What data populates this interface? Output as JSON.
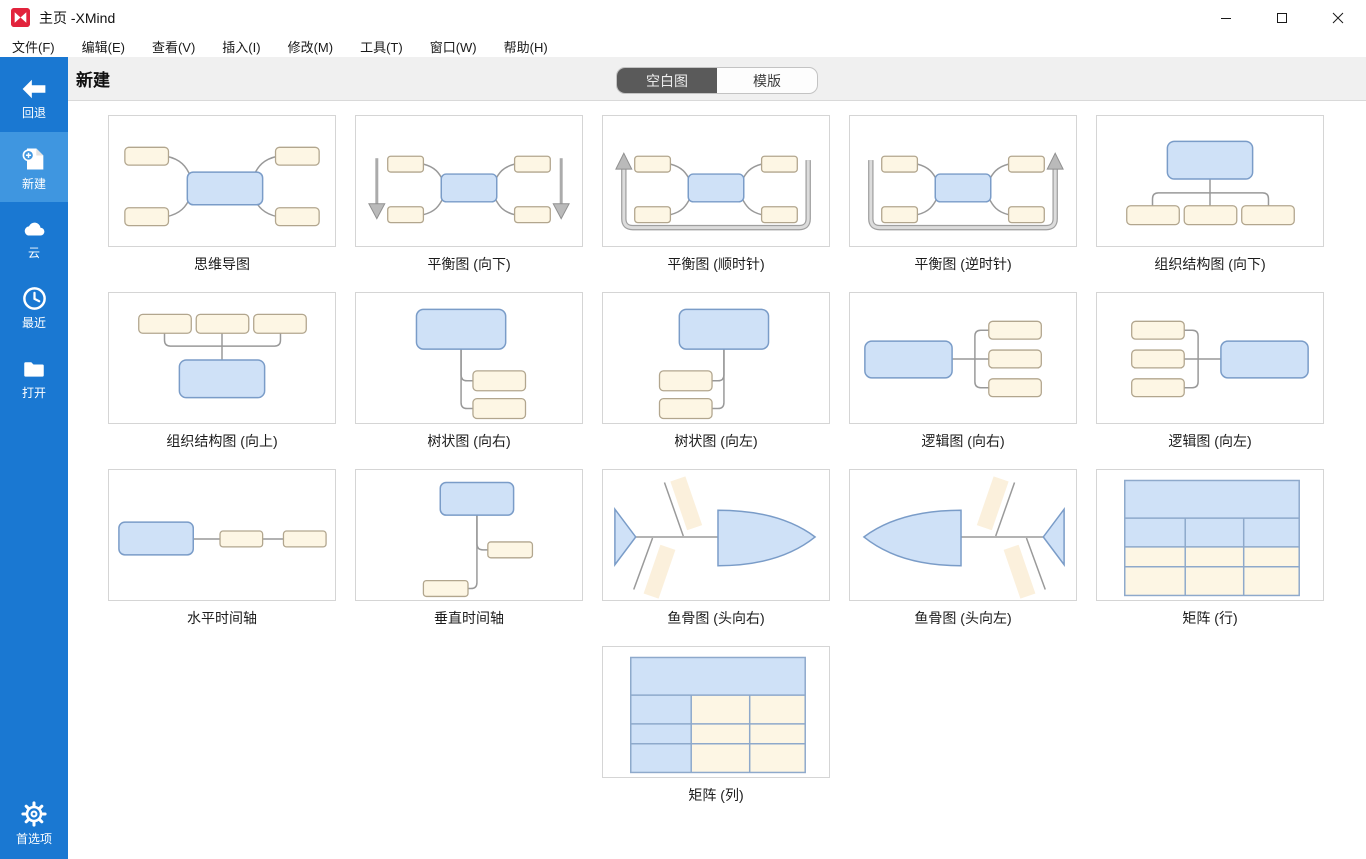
{
  "window": {
    "title": "主页 -XMind",
    "app_name": "XMind"
  },
  "menu": {
    "items": [
      "文件(F)",
      "编辑(E)",
      "查看(V)",
      "插入(I)",
      "修改(M)",
      "工具(T)",
      "窗口(W)",
      "帮助(H)"
    ]
  },
  "sidebar": {
    "items": [
      {
        "id": "back",
        "label": "回退",
        "icon": "back-arrow-icon",
        "selected": false
      },
      {
        "id": "new",
        "label": "新建",
        "icon": "new-document-icon",
        "selected": true
      },
      {
        "id": "cloud",
        "label": "云",
        "icon": "cloud-icon",
        "selected": false
      },
      {
        "id": "recent",
        "label": "最近",
        "icon": "clock-icon",
        "selected": false
      },
      {
        "id": "open",
        "label": "打开",
        "icon": "folder-icon",
        "selected": false
      }
    ],
    "bottom_item": {
      "id": "preferences",
      "label": "首选项",
      "icon": "gear-icon",
      "selected": false
    }
  },
  "header": {
    "title": "新建",
    "tabs": [
      {
        "label": "空白图",
        "selected": true
      },
      {
        "label": "模版",
        "selected": false
      }
    ]
  },
  "templates": [
    {
      "id": "mind-map",
      "label": "思维导图"
    },
    {
      "id": "balance-down",
      "label": "平衡图 (向下)"
    },
    {
      "id": "balance-clockwise",
      "label": "平衡图 (顺时针)"
    },
    {
      "id": "balance-counter",
      "label": "平衡图 (逆时针)"
    },
    {
      "id": "org-down",
      "label": "组织结构图 (向下)"
    },
    {
      "id": "org-up",
      "label": "组织结构图 (向上)"
    },
    {
      "id": "tree-right",
      "label": "树状图 (向右)"
    },
    {
      "id": "tree-left",
      "label": "树状图 (向左)"
    },
    {
      "id": "logic-right",
      "label": "逻辑图 (向右)"
    },
    {
      "id": "logic-left",
      "label": "逻辑图 (向左)"
    },
    {
      "id": "timeline-h",
      "label": "水平时间轴"
    },
    {
      "id": "timeline-v",
      "label": "垂直时间轴"
    },
    {
      "id": "fishbone-right",
      "label": "鱼骨图 (头向右)"
    },
    {
      "id": "fishbone-left",
      "label": "鱼骨图 (头向左)"
    },
    {
      "id": "matrix-row",
      "label": "矩阵 (行)"
    },
    {
      "id": "matrix-col",
      "label": "矩阵 (列)"
    }
  ],
  "colors": {
    "sidebar": "#1a78d2",
    "sidebar_selected": "#3f96e0",
    "header_bg": "#f0f0f0",
    "tab_selected_bg": "#5a5a5a",
    "logo_red": "#e2233c",
    "node_blue_fill": "#cfe1f7",
    "node_blue_stroke": "#7a9cc8",
    "node_cream_fill": "#fdf6e4",
    "node_cream_stroke": "#b2a68e",
    "connector_gray": "#999999",
    "matrix_stroke": "#8ea9cb"
  }
}
